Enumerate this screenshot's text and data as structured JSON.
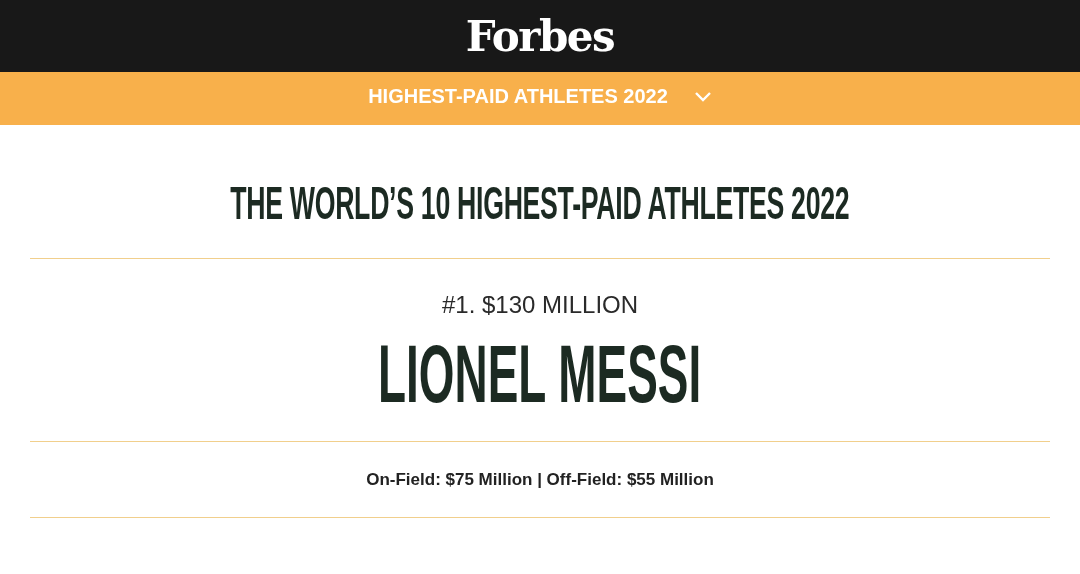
{
  "header": {
    "brand": "Forbes"
  },
  "nav_bar": {
    "label": "HIGHEST-PAID ATHLETES 2022",
    "expanded": false
  },
  "article": {
    "title": "THE WORLD’S 10 HIGHEST-PAID ATHLETES 2022",
    "entry": {
      "rank": "#1. $130 MILLION",
      "name": "LIONEL MESSI",
      "earnings": "On-Field: $75 Million | Off-Field: $55 Million"
    }
  }
}
